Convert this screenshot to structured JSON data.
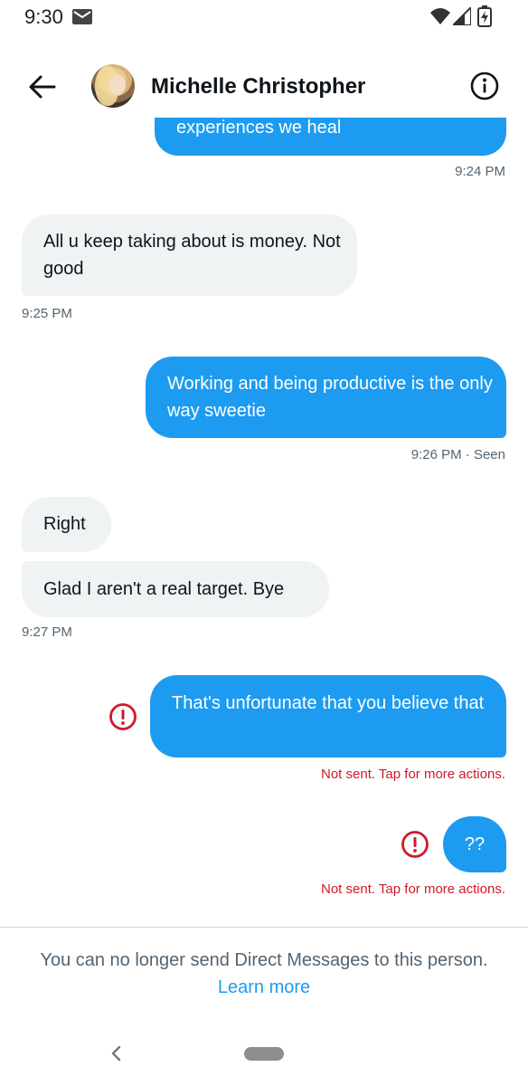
{
  "status_bar": {
    "time": "9:30",
    "icons": [
      "mail-icon",
      "wifi-icon",
      "signal-icon",
      "battery-charging-icon"
    ]
  },
  "header": {
    "contact_name": "Michelle Christopher",
    "back_icon": "arrow-left-icon",
    "info_icon": "info-icon"
  },
  "colors": {
    "accent": "#1d9bf0",
    "incoming_bubble": "#eff3f4",
    "error": "#d0182c",
    "secondary_text": "#536471"
  },
  "messages": [
    {
      "direction": "outgoing",
      "text": "experiences we heal",
      "partial": true
    },
    {
      "direction": "incoming",
      "text": "All u keep taking about is money. Not good"
    },
    {
      "direction": "outgoing",
      "text": "Working and being productive is the only way sweetie"
    },
    {
      "direction": "incoming",
      "text": "Right"
    },
    {
      "direction": "incoming",
      "text": "Glad I aren't a real target. Bye"
    },
    {
      "direction": "outgoing",
      "text": "That's unfortunate that you believe that",
      "failed": true
    },
    {
      "direction": "outgoing",
      "text": "??",
      "failed": true
    }
  ],
  "timestamps": [
    "9:24 PM",
    "9:25 PM",
    "9:26 PM · Seen",
    "9:27 PM"
  ],
  "errors": {
    "not_sent": "Not sent. Tap for more actions."
  },
  "footer": {
    "message": "You can no longer send Direct Messages to this person.",
    "link": "Learn more"
  }
}
